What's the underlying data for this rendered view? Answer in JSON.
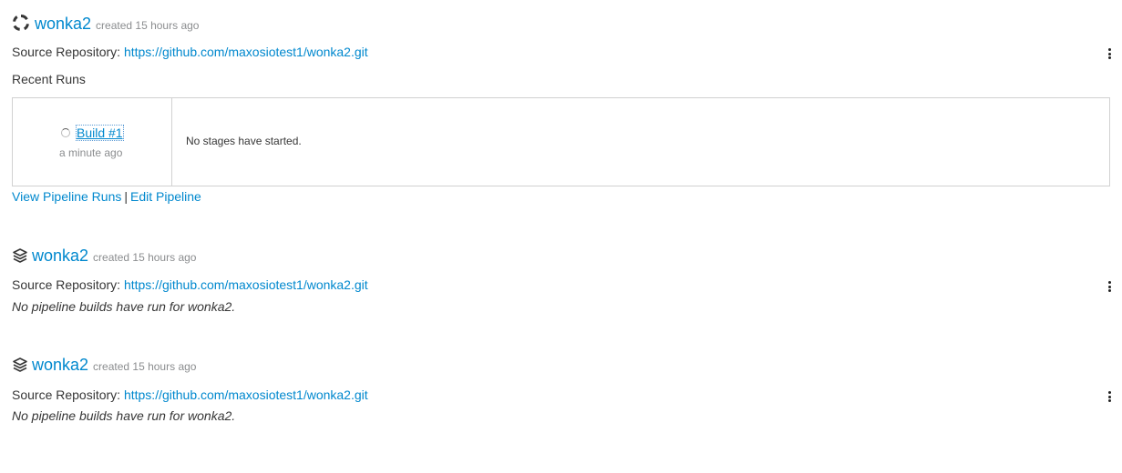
{
  "pipelines": [
    {
      "name": "wonka2",
      "created": "created 15 hours ago",
      "source_label": "Source Repository:",
      "source_url": "https://github.com/maxosiotest1/wonka2.git",
      "icon": "pipeline-running-icon",
      "recent_runs_label": "Recent Runs",
      "run": {
        "build": "Build #1",
        "time": "a minute ago",
        "stages": "No stages have started."
      },
      "links": {
        "view_runs": "View Pipeline Runs",
        "separator": "|",
        "edit": "Edit Pipeline"
      }
    },
    {
      "name": "wonka2",
      "created": "created 15 hours ago",
      "source_label": "Source Repository:",
      "source_url": "https://github.com/maxosiotest1/wonka2.git",
      "icon": "layers-icon",
      "empty_note": "No pipeline builds have run for wonka2."
    },
    {
      "name": "wonka2",
      "created": "created 15 hours ago",
      "source_label": "Source Repository:",
      "source_url": "https://github.com/maxosiotest1/wonka2.git",
      "icon": "layers-icon",
      "empty_note": "No pipeline builds have run for wonka2."
    }
  ],
  "colors": {
    "link": "#0088ce",
    "muted": "#8b8d8f",
    "border": "#d1d1d1"
  }
}
